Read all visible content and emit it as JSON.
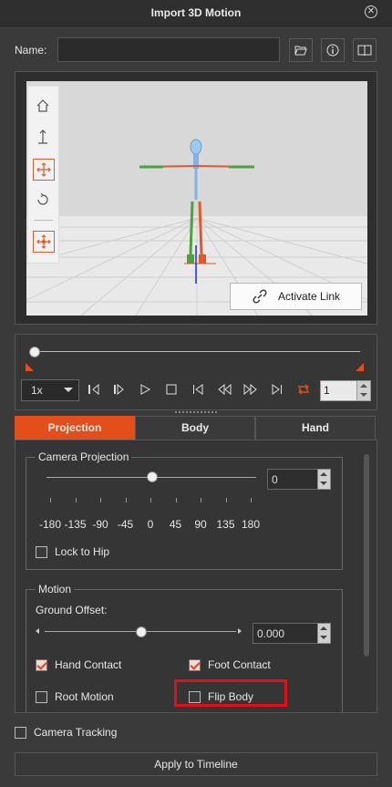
{
  "window": {
    "title": "Import 3D Motion"
  },
  "name_field": {
    "label": "Name:",
    "value": ""
  },
  "header_icons": [
    "folder-open-icon",
    "info-icon",
    "book-icon"
  ],
  "viewport": {
    "activate_link": "Activate Link"
  },
  "timeline": {
    "speed": "1x",
    "frame": "1",
    "progress": 0.0
  },
  "tabs": [
    {
      "label": "Projection",
      "active": true
    },
    {
      "label": "Body",
      "active": false
    },
    {
      "label": "Hand",
      "active": false
    }
  ],
  "camera_projection": {
    "title": "Camera Projection",
    "slider_value": 0,
    "value": "0",
    "ticks": [
      "-180",
      "-135",
      "-90",
      "-45",
      "0",
      "45",
      "90",
      "135",
      "180"
    ],
    "lock_to_hip": {
      "label": "Lock to Hip",
      "checked": false
    }
  },
  "motion": {
    "title": "Motion",
    "ground_offset_label": "Ground Offset:",
    "ground_offset_value": "0.000",
    "ground_offset_level": 0.5,
    "hand_contact": {
      "label": "Hand Contact",
      "checked": true
    },
    "foot_contact": {
      "label": "Foot Contact",
      "checked": true
    },
    "root_motion": {
      "label": "Root Motion",
      "checked": false
    },
    "flip_body": {
      "label": "Flip Body",
      "checked": false
    }
  },
  "camera_tracking": {
    "label": "Camera Tracking",
    "checked": false
  },
  "apply_button": "Apply to Timeline",
  "colors": {
    "accent": "#e34e1a",
    "highlight": "#e0101a"
  }
}
